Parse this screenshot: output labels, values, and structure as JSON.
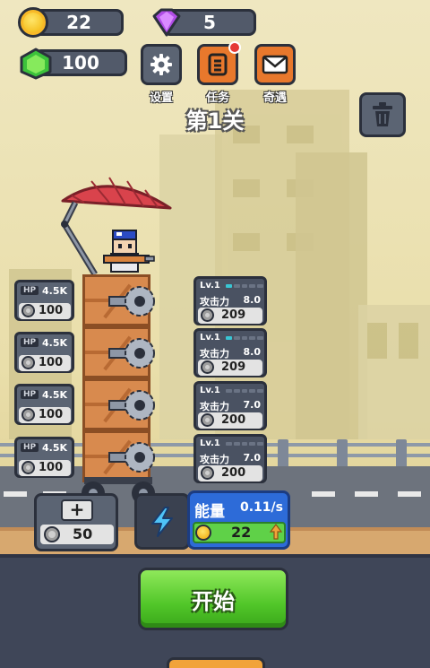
{
  "resources": {
    "coins": "22",
    "gems": "5",
    "emeralds": "100"
  },
  "menu": {
    "settings_label": "设置",
    "tasks_label": "任务",
    "events_label": "奇遇"
  },
  "level": {
    "title": "第1关"
  },
  "colors": {
    "settings_bg": "#5b6473",
    "tasks_bg": "#e8782c",
    "events_bg": "#e8782c",
    "start_green": "#51c629",
    "energy_blue": "#2d6bd8"
  },
  "hp_cards": [
    {
      "tag": "HP",
      "value": "4.5K",
      "cost": "100"
    },
    {
      "tag": "HP",
      "value": "4.5K",
      "cost": "100"
    },
    {
      "tag": "HP",
      "value": "4.5K",
      "cost": "100"
    },
    {
      "tag": "HP",
      "value": "4.5K",
      "cost": "100"
    }
  ],
  "weapon_cards": [
    {
      "level": "Lv.1",
      "attack_label": "攻击力",
      "attack": "8.0",
      "cost": "209",
      "progress_segments": 1
    },
    {
      "level": "Lv.1",
      "attack_label": "攻击力",
      "attack": "8.0",
      "cost": "209",
      "progress_segments": 1
    },
    {
      "level": "Lv.1",
      "attack_label": "攻击力",
      "attack": "7.0",
      "cost": "200",
      "progress_segments": 0
    },
    {
      "level": "Lv.1",
      "attack_label": "攻击力",
      "attack": "7.0",
      "cost": "200",
      "progress_segments": 0
    }
  ],
  "add_floor": {
    "icon": "plus-icon",
    "cost": "50"
  },
  "energy": {
    "label": "能量",
    "rate": "0.11/s",
    "cost": "22"
  },
  "start_button": {
    "label": "开始"
  }
}
